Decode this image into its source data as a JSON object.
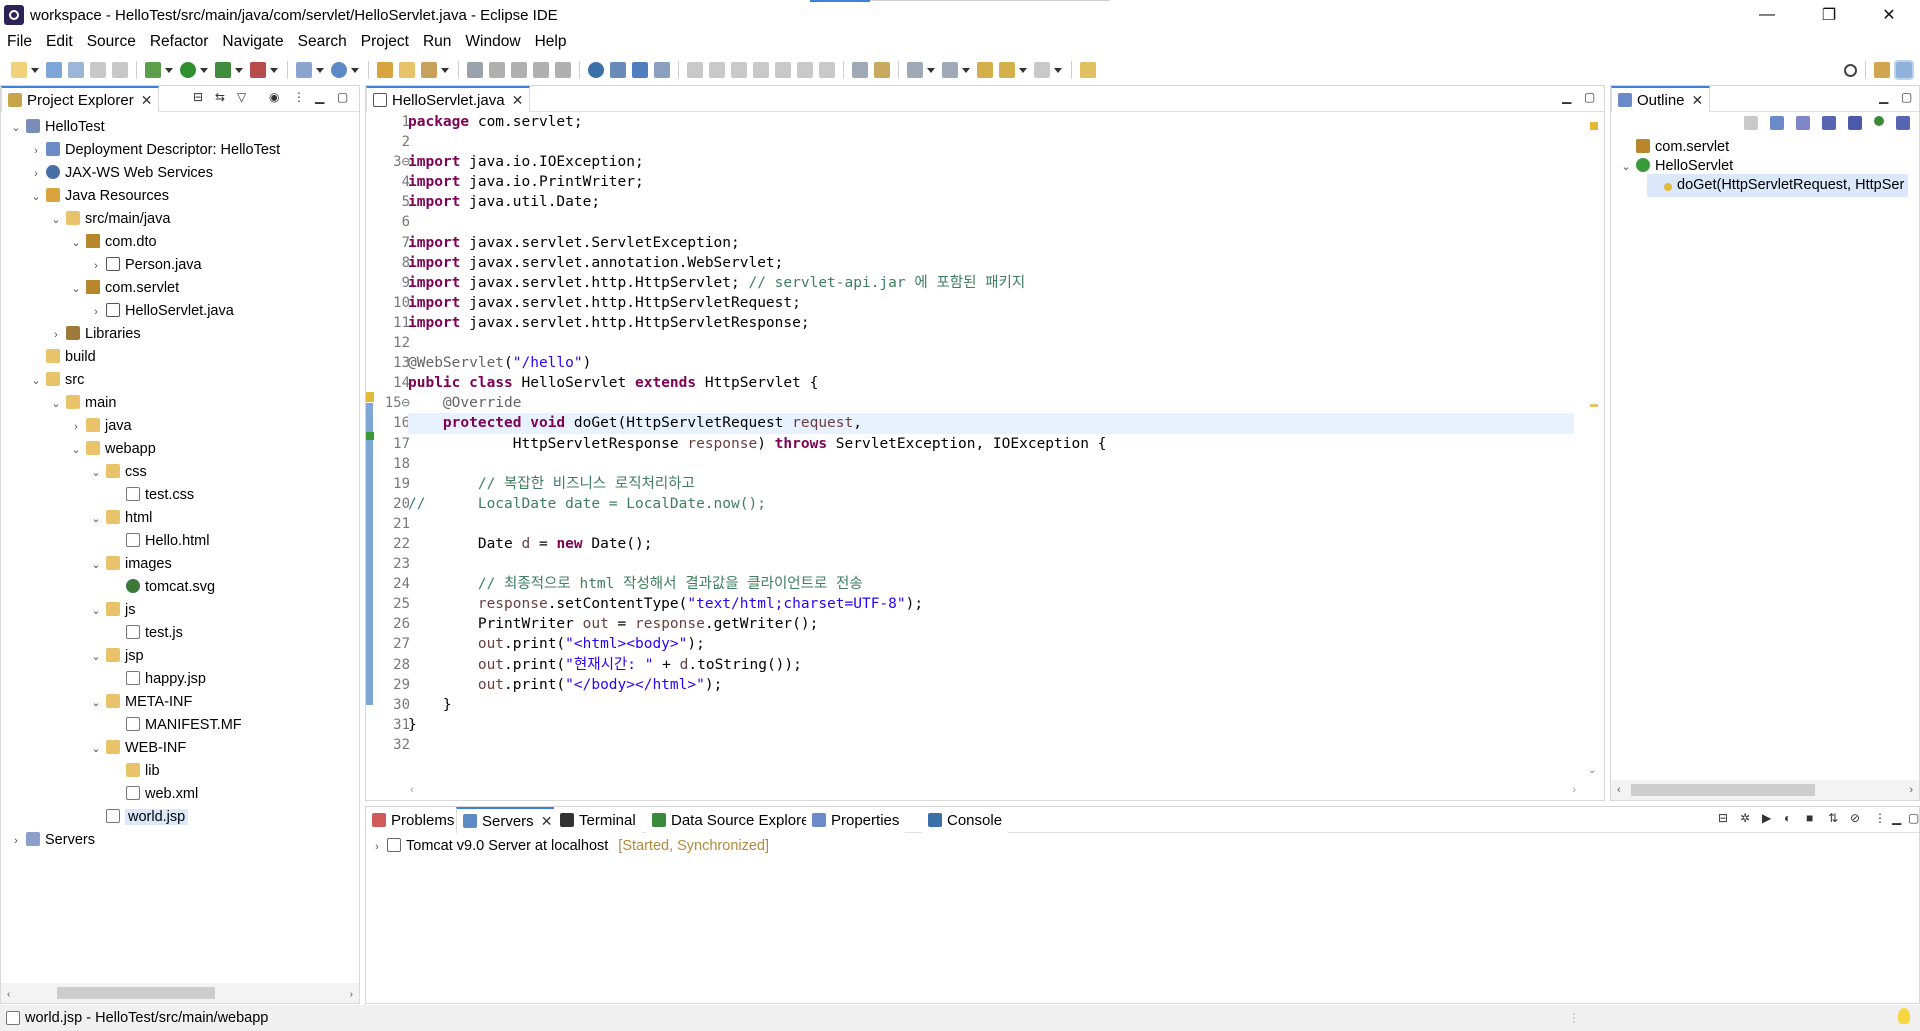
{
  "window": {
    "title": "workspace - HelloTest/src/main/java/com/servlet/HelloServlet.java - Eclipse IDE",
    "minimize_glyph": "—",
    "maximize_glyph": "❐",
    "close_glyph": "✕"
  },
  "menu": [
    "File",
    "Edit",
    "Source",
    "Refactor",
    "Navigate",
    "Search",
    "Project",
    "Run",
    "Window",
    "Help"
  ],
  "project_explorer": {
    "tab_label": "Project Explorer",
    "items": [
      {
        "label": "HelloTest",
        "level": 0,
        "chev": "v",
        "icon": "project"
      },
      {
        "label": "Deployment Descriptor: HelloTest",
        "level": 1,
        "chev": ">",
        "icon": "desc"
      },
      {
        "label": "JAX-WS Web Services",
        "level": 1,
        "chev": ">",
        "icon": "ws"
      },
      {
        "label": "Java Resources",
        "level": 1,
        "chev": "v",
        "icon": "jres"
      },
      {
        "label": "src/main/java",
        "level": 2,
        "chev": "v",
        "icon": "srcf"
      },
      {
        "label": "com.dto",
        "level": 3,
        "chev": "v",
        "icon": "pkg"
      },
      {
        "label": "Person.java",
        "level": 4,
        "chev": ">",
        "icon": "java"
      },
      {
        "label": "com.servlet",
        "level": 3,
        "chev": "v",
        "icon": "pkg"
      },
      {
        "label": "HelloServlet.java",
        "level": 4,
        "chev": ">",
        "icon": "java"
      },
      {
        "label": "Libraries",
        "level": 2,
        "chev": ">",
        "icon": "lib"
      },
      {
        "label": "build",
        "level": 1,
        "chev": "",
        "icon": "folder"
      },
      {
        "label": "src",
        "level": 1,
        "chev": "v",
        "icon": "folder"
      },
      {
        "label": "main",
        "level": 2,
        "chev": "v",
        "icon": "folder"
      },
      {
        "label": "java",
        "level": 3,
        "chev": ">",
        "icon": "folder"
      },
      {
        "label": "webapp",
        "level": 3,
        "chev": "v",
        "icon": "folder"
      },
      {
        "label": "css",
        "level": 4,
        "chev": "v",
        "icon": "folder"
      },
      {
        "label": "test.css",
        "level": 5,
        "chev": "",
        "icon": "file"
      },
      {
        "label": "html",
        "level": 4,
        "chev": "v",
        "icon": "folder"
      },
      {
        "label": "Hello.html",
        "level": 5,
        "chev": "",
        "icon": "file"
      },
      {
        "label": "images",
        "level": 4,
        "chev": "v",
        "icon": "folder"
      },
      {
        "label": "tomcat.svg",
        "level": 5,
        "chev": "",
        "icon": "svg"
      },
      {
        "label": "js",
        "level": 4,
        "chev": "v",
        "icon": "folder"
      },
      {
        "label": "test.js",
        "level": 5,
        "chev": "",
        "icon": "file"
      },
      {
        "label": "jsp",
        "level": 4,
        "chev": "v",
        "icon": "folder"
      },
      {
        "label": "happy.jsp",
        "level": 5,
        "chev": "",
        "icon": "file"
      },
      {
        "label": "META-INF",
        "level": 4,
        "chev": "v",
        "icon": "folder"
      },
      {
        "label": "MANIFEST.MF",
        "level": 5,
        "chev": "",
        "icon": "file"
      },
      {
        "label": "WEB-INF",
        "level": 4,
        "chev": "v",
        "icon": "folder"
      },
      {
        "label": "lib",
        "level": 5,
        "chev": "",
        "icon": "folder"
      },
      {
        "label": "web.xml",
        "level": 5,
        "chev": "",
        "icon": "xml"
      },
      {
        "label": "world.jsp",
        "level": 4,
        "chev": "",
        "icon": "file",
        "selected": true
      },
      {
        "label": "Servers",
        "level": 0,
        "chev": ">",
        "icon": "servers"
      }
    ]
  },
  "editor": {
    "tab_label": "HelloServlet.java",
    "lines": [
      [
        [
          "kw",
          "package"
        ],
        [
          "",
          " com.servlet;"
        ]
      ],
      [],
      [
        [
          "kw",
          "import"
        ],
        [
          "",
          " java.io.IOException;"
        ]
      ],
      [
        [
          "kw",
          "import"
        ],
        [
          "",
          " java.io.PrintWriter;"
        ]
      ],
      [
        [
          "kw",
          "import"
        ],
        [
          "",
          " java.util.Date;"
        ]
      ],
      [],
      [
        [
          "kw",
          "import"
        ],
        [
          "",
          " javax.servlet.ServletException;"
        ]
      ],
      [
        [
          "kw",
          "import"
        ],
        [
          "",
          " javax.servlet.annotation.WebServlet;"
        ]
      ],
      [
        [
          "kw",
          "import"
        ],
        [
          "",
          " javax.servlet.http.HttpServlet; "
        ],
        [
          "cm",
          "// servlet-api.jar 에 포함된 패키지"
        ]
      ],
      [
        [
          "kw",
          "import"
        ],
        [
          "",
          " javax.servlet.http.HttpServletRequest;"
        ]
      ],
      [
        [
          "kw",
          "import"
        ],
        [
          "",
          " javax.servlet.http.HttpServletResponse;"
        ]
      ],
      [],
      [
        [
          "ann",
          "@WebServlet"
        ],
        [
          "",
          "("
        ],
        [
          "str",
          "\"/hello\""
        ],
        [
          "",
          ")"
        ]
      ],
      [
        [
          "kw",
          "public"
        ],
        [
          "",
          " "
        ],
        [
          "kw",
          "class"
        ],
        [
          "",
          " HelloServlet "
        ],
        [
          "kw",
          "extends"
        ],
        [
          "",
          " HttpServlet {"
        ]
      ],
      [
        [
          "",
          "    "
        ],
        [
          "ann",
          "@Override"
        ]
      ],
      [
        [
          "",
          "    "
        ],
        [
          "kw",
          "protected"
        ],
        [
          "",
          " "
        ],
        [
          "kw",
          "void"
        ],
        [
          "",
          " doGet(HttpServletRequest "
        ],
        [
          "var",
          "request"
        ],
        [
          "",
          ","
        ]
      ],
      [
        [
          "",
          "            HttpServletResponse "
        ],
        [
          "var",
          "response"
        ],
        [
          "",
          ") "
        ],
        [
          "kw",
          "throws"
        ],
        [
          "",
          " ServletException, IOException {"
        ]
      ],
      [],
      [
        [
          "",
          "        "
        ],
        [
          "cm",
          "// 복잡한 비즈니스 로직처리하고"
        ]
      ],
      [
        [
          "cm",
          "//      LocalDate date = LocalDate.now();"
        ]
      ],
      [],
      [
        [
          "",
          "        Date "
        ],
        [
          "var",
          "d"
        ],
        [
          "",
          " = "
        ],
        [
          "kw",
          "new"
        ],
        [
          "",
          " Date();"
        ]
      ],
      [],
      [
        [
          "",
          "        "
        ],
        [
          "cm",
          "// 최종적으로 html 작성해서 결과값을 클라이언트로 전송"
        ]
      ],
      [
        [
          "",
          "        "
        ],
        [
          "var",
          "response"
        ],
        [
          "",
          ".setContentType("
        ],
        [
          "str",
          "\"text/html;charset=UTF-8\""
        ],
        [
          "",
          ");"
        ]
      ],
      [
        [
          "",
          "        PrintWriter "
        ],
        [
          "var",
          "out"
        ],
        [
          "",
          " = "
        ],
        [
          "var",
          "response"
        ],
        [
          "",
          ".getWriter();"
        ]
      ],
      [
        [
          "",
          "        "
        ],
        [
          "var",
          "out"
        ],
        [
          "",
          ".print("
        ],
        [
          "str",
          "\"<html><body>\""
        ],
        [
          "",
          ");"
        ]
      ],
      [
        [
          "",
          "        "
        ],
        [
          "var",
          "out"
        ],
        [
          "",
          ".print("
        ],
        [
          "str",
          "\"현재시간: \""
        ],
        [
          "",
          " + "
        ],
        [
          "var",
          "d"
        ],
        [
          "",
          ".toString());"
        ]
      ],
      [
        [
          "",
          "        "
        ],
        [
          "var",
          "out"
        ],
        [
          "",
          ".print("
        ],
        [
          "str",
          "\"</body></html>\""
        ],
        [
          "",
          ");"
        ]
      ],
      [
        [
          "",
          "    }"
        ]
      ],
      [
        [
          "",
          "}"
        ]
      ],
      []
    ],
    "fold_lines": [
      3,
      15
    ],
    "current_line": 16
  },
  "outline": {
    "tab_label": "Outline",
    "items": [
      {
        "label": "com.servlet",
        "level": 0,
        "chev": ""
      },
      {
        "label": "HelloServlet",
        "level": 0,
        "chev": "v"
      },
      {
        "label": "doGet(HttpServletRequest, HttpSer",
        "level": 1,
        "chev": "",
        "selected": true
      }
    ]
  },
  "bottom_panel": {
    "tabs": [
      "Problems",
      "Servers",
      "Terminal",
      "Data Source Explorer",
      "Properties",
      "Console"
    ],
    "active_tab": "Servers",
    "servers": [
      {
        "name": "Tomcat v9.0 Server at localhost",
        "state": "[Started, Synchronized]"
      }
    ]
  },
  "statusbar": {
    "text": "world.jsp - HelloTest/src/main/webapp"
  },
  "colors": {
    "accent": "#3c82d8",
    "keyword": "#7f0055",
    "string": "#2a00ff",
    "comment": "#3f7f5f"
  }
}
